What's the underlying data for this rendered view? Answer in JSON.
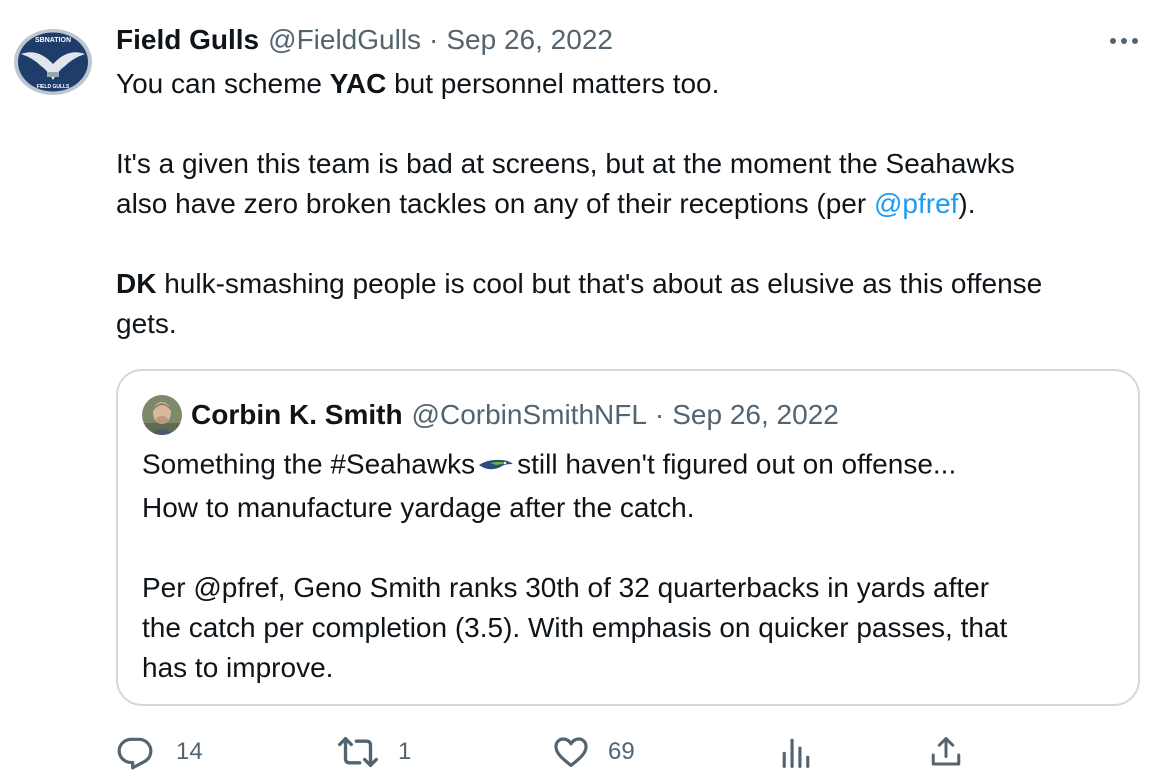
{
  "tweet": {
    "author_name": "Field Gulls",
    "author_handle": "@FieldGulls",
    "separator": "·",
    "date": "Sep 26, 2022",
    "avatar_text_top": "SBNATION",
    "avatar_text_bottom": "FIELD GULLS",
    "text": {
      "p1_pre": "You can scheme ",
      "p1_bold": "YAC",
      "p1_post": " but personnel matters too.",
      "p2_line1": "It's a given this team is bad at screens, but at the moment the Seahawks",
      "p2_line2_pre": "also have zero broken tackles on any of their receptions (per ",
      "p2_mention": "@pfref",
      "p2_line2_post": ").",
      "p3_bold": "DK",
      "p3_line1_rest": " hulk-smashing people is cool but that's about as elusive as this offense",
      "p3_line2": "gets."
    }
  },
  "quoted": {
    "author_name": "Corbin K. Smith",
    "author_handle": "@CorbinSmithNFL",
    "separator": "·",
    "date": "Sep 26, 2022",
    "text": {
      "l1_pre": "Something the #Seahawks",
      "l1_post": "still haven't figured out on offense...",
      "l2": "How to manufacture yardage after the catch.",
      "l3": "Per @pfref, Geno Smith ranks 30th of 32 quarterbacks in yards after",
      "l4": "the catch per completion (3.5). With emphasis on quicker passes, that",
      "l5": "has to improve."
    }
  },
  "actions": {
    "replies": "14",
    "retweets": "1",
    "likes": "69"
  },
  "icons": [
    "more-icon",
    "reply-icon",
    "retweet-icon",
    "like-icon",
    "views-icon",
    "share-icon",
    "seahawks-emoji-icon"
  ],
  "colors": {
    "link": "#1d9bf0",
    "muted": "#536471",
    "border": "#cfd9de",
    "text": "#0f1419"
  }
}
